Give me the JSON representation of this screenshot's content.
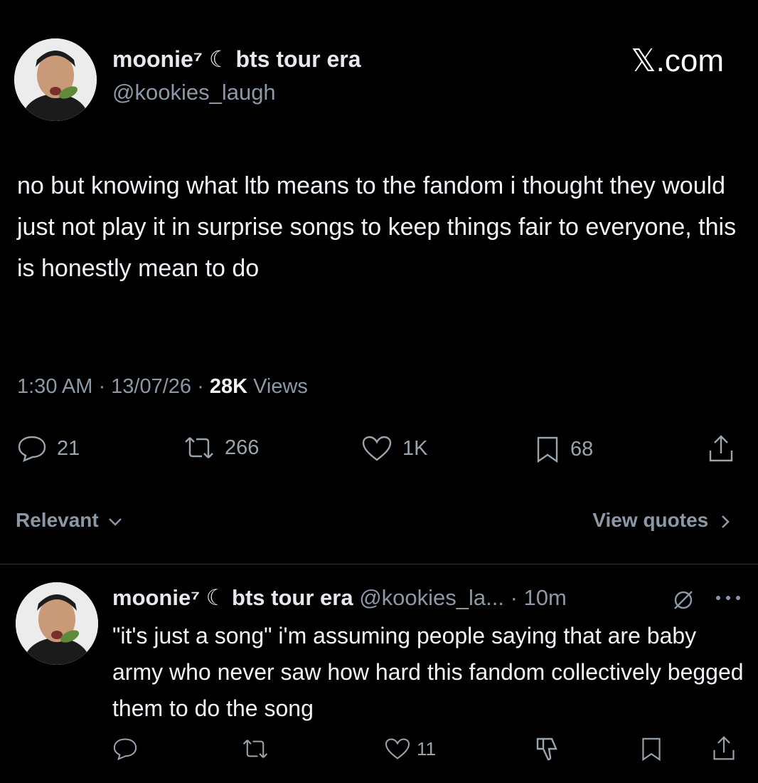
{
  "main_tweet": {
    "display_name": "moonie⁷ ☾ bts tour era",
    "handle": "@kookies_laugh",
    "brand": "𝕏.com",
    "text": "no but knowing what ltb means to the fandom i thought they would just not play it in surprise songs to keep things fair to everyone, this is honestly mean to do",
    "time": "1:30 AM · 13/07/26 · ",
    "views_count": "28K",
    "views_label": " Views",
    "actions": {
      "replies": "21",
      "reposts": "266",
      "likes": "1K",
      "bookmarks": "68"
    }
  },
  "sort": {
    "label": "Relevant",
    "quotes_label": "View quotes"
  },
  "reply": {
    "display_name": "moonie⁷ ☾ bts tour era",
    "handle_time": "@kookies_la... · 10m",
    "text": "\"it's just a song\" i'm assuming people saying that are baby army who never saw how hard this fandom collectively begged them to do the song",
    "actions": {
      "likes": "11"
    }
  },
  "icons": {
    "reply": "reply-icon",
    "repost": "repost-icon",
    "like": "heart-icon",
    "bookmark": "bookmark-icon",
    "share": "share-icon",
    "dislike": "dislike-icon",
    "more": "more-icon",
    "chevron": "chevron-down-icon"
  }
}
